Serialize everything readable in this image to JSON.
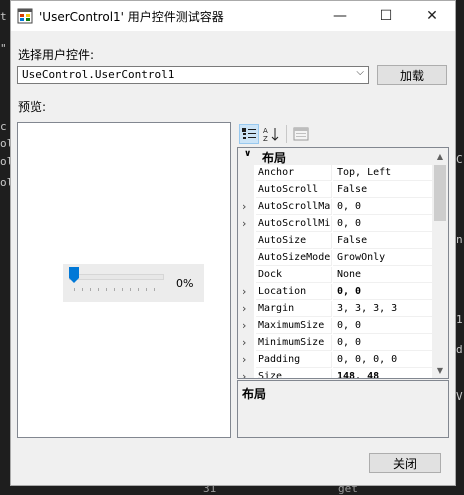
{
  "window": {
    "title": "'UserControl1' 用户控件测试容器",
    "min_glyph": "—",
    "max_glyph": "☐",
    "close_glyph": "✕"
  },
  "select_label": "选择用户控件:",
  "combo": {
    "value": "UseControl.UserControl1",
    "arrow": "⌵"
  },
  "load_button": "加载",
  "preview_label": "预览:",
  "control": {
    "percent": "0%",
    "value": 0
  },
  "property_grid": {
    "category": "布局",
    "category_expander": "∨",
    "rows": [
      {
        "exp": "",
        "name": "Anchor",
        "value": "Top, Left",
        "bold": false
      },
      {
        "exp": "",
        "name": "AutoScroll",
        "value": "False",
        "bold": false
      },
      {
        "exp": "›",
        "name": "AutoScrollMa",
        "value": "0, 0",
        "bold": false
      },
      {
        "exp": "›",
        "name": "AutoScrollMi",
        "value": "0, 0",
        "bold": false
      },
      {
        "exp": "",
        "name": "AutoSize",
        "value": "False",
        "bold": false
      },
      {
        "exp": "",
        "name": "AutoSizeMode",
        "value": "GrowOnly",
        "bold": false
      },
      {
        "exp": "",
        "name": "Dock",
        "value": "None",
        "bold": false
      },
      {
        "exp": "›",
        "name": "Location",
        "value": "0, 0",
        "bold": true
      },
      {
        "exp": "›",
        "name": "Margin",
        "value": "3, 3, 3, 3",
        "bold": false
      },
      {
        "exp": "›",
        "name": "MaximumSize",
        "value": "0, 0",
        "bold": false
      },
      {
        "exp": "›",
        "name": "MinimumSize",
        "value": "0, 0",
        "bold": false
      },
      {
        "exp": "›",
        "name": "Padding",
        "value": "0, 0, 0, 0",
        "bold": false
      },
      {
        "exp": "›",
        "name": "Size",
        "value": "148, 48",
        "bold": true
      }
    ],
    "description_title": "布局",
    "scroll_up": "▲",
    "scroll_down": "▼"
  },
  "close_button": "关闭",
  "background": {
    "left_lines": [
      "t",
      "\"",
      "",
      "",
      "c",
      "ol",
      "ol",
      "ol"
    ],
    "right_chars": [
      "C",
      "n",
      "1",
      "d",
      "V"
    ],
    "bottom_left": "31",
    "bottom_right": "get"
  },
  "colors": {
    "accent_thumb": "#0078d7",
    "icon_red": "#d83b01",
    "icon_blue": "#0078d7"
  }
}
